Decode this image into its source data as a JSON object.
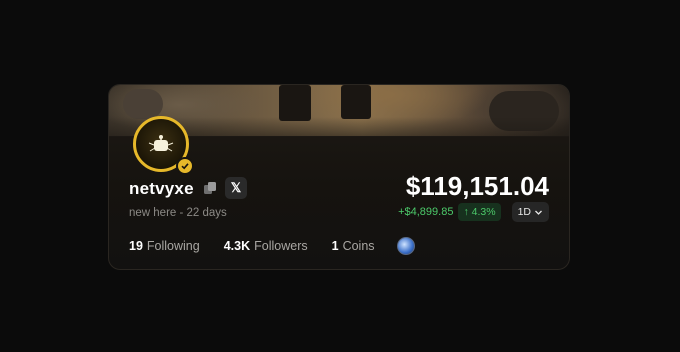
{
  "profile": {
    "username": "netvyxe",
    "subtitle": "new here - 22 days",
    "x_label": "𝕏"
  },
  "portfolio": {
    "balance": "$119,151.04",
    "change_abs": "+$4,899.85",
    "change_pct": "↑ 4.3%",
    "period": "1D",
    "period_chevron": "⌄"
  },
  "stats": {
    "following_count": "19",
    "following_label": "Following",
    "followers_count": "4.3K",
    "followers_label": "Followers",
    "coins_count": "1",
    "coins_label": "Coins"
  },
  "colors": {
    "accent_gold": "#e6b82a",
    "positive_green": "#4cc96a",
    "card_bg": "#1a1612"
  },
  "icons": {
    "avatar": "robot-icon",
    "verified": "check-icon",
    "copy": "copy-icon",
    "social": "x-logo-icon",
    "coin": "coin-icon",
    "period": "chevron-down-icon"
  }
}
